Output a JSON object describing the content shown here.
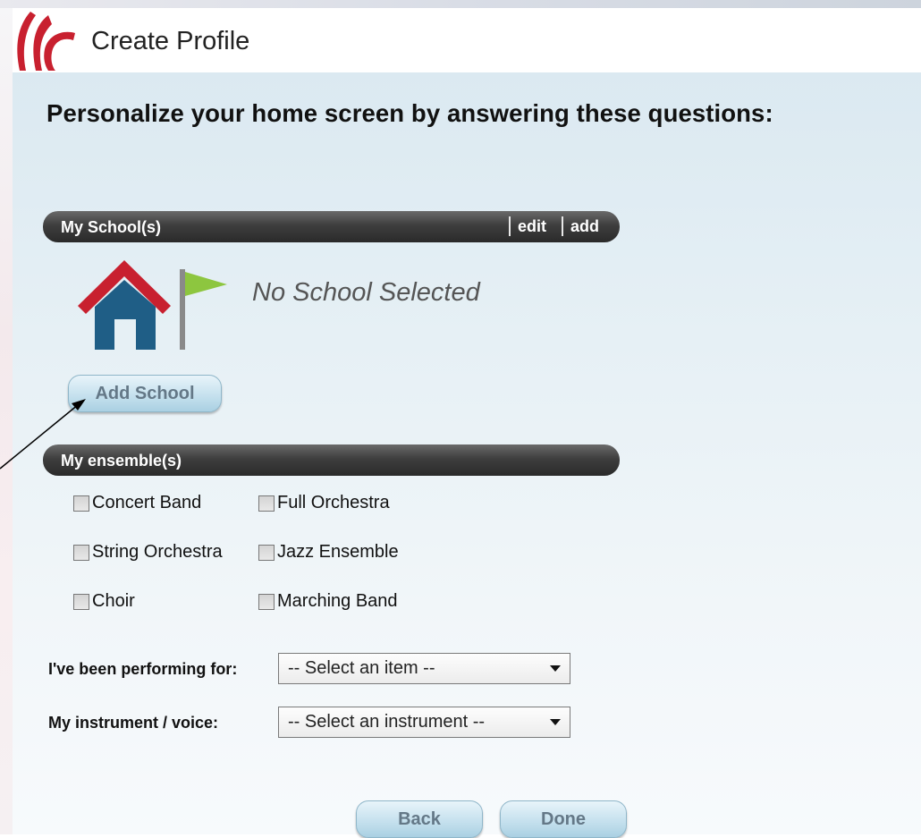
{
  "header": {
    "title": "Create Profile"
  },
  "main": {
    "heading": "Personalize your home screen by answering these questions:"
  },
  "schools": {
    "section_label": "My School(s)",
    "edit_label": "edit",
    "add_label": "add",
    "empty_text": "No School Selected",
    "add_button": "Add School"
  },
  "ensembles": {
    "section_label": "My ensemble(s)",
    "options": [
      "Concert Band",
      "Full Orchestra",
      "String Orchestra",
      "Jazz Ensemble",
      "Choir",
      "Marching Band"
    ]
  },
  "performing": {
    "label": "I've been performing for:",
    "selected": "-- Select an item --"
  },
  "instrument": {
    "label": "My instrument / voice:",
    "selected": "-- Select an instrument --"
  },
  "footer": {
    "back_label": "Back",
    "done_label": "Done"
  },
  "colors": {
    "brand_red": "#c8202f",
    "house_blue": "#1f5e86",
    "flag_green": "#8dc63f",
    "section_bar": "#333333"
  },
  "icons": [
    "logo-icon",
    "house-icon",
    "flag-icon",
    "dropdown-caret-icon"
  ]
}
